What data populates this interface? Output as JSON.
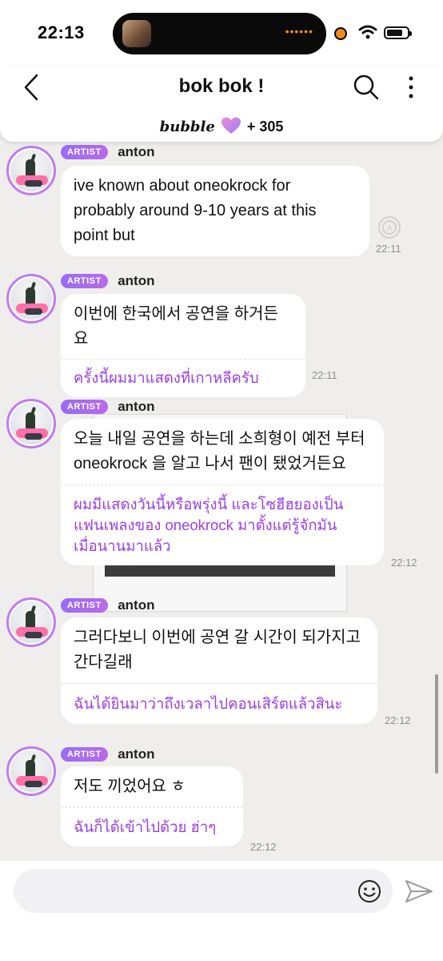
{
  "status_bar": {
    "time": "22:13",
    "island_indicator": "••••••"
  },
  "header": {
    "title": "bok bok !",
    "bubble_label": "bubble",
    "count": "+ 305",
    "icons": {
      "back": "chevron-left-icon",
      "search": "search-icon",
      "more": "more-vertical-icon",
      "heart": "heart-icon"
    }
  },
  "messages": [
    {
      "badge": "ARTIST",
      "name": "anton",
      "text": [
        "ive known about oneokrock for",
        "probably around 9-10 years at this",
        "point but"
      ],
      "translation": [],
      "time": "22:11"
    },
    {
      "badge": "ARTIST",
      "name": "anton",
      "text": [
        "이번에 한국에서 공연을 하거든요"
      ],
      "translation": [
        "ครั้งนี้ผมมาแสดงที่เกาหลีครับ"
      ],
      "time": "22:11"
    },
    {
      "badge": "ARTIST",
      "name": "anton",
      "text": [
        "오늘 내일 공연을 하는데 소희형이 예전 부터",
        "oneokrock 을 알고 나서 팬이 됐었거든요"
      ],
      "translation": [
        "ผมมีแสดงวันนี้หรือพรุ่งนี้ และโซฮีฮยองเป็น",
        "แฟนเพลงของ oneokrock มาตั้งแต่รู้จักมัน",
        "เมื่อนานมาแล้ว"
      ],
      "time": "22:12"
    },
    {
      "badge": "ARTIST",
      "name": "anton",
      "text": [
        "그러다보니 이번에 공연 갈 시간이 되가지고",
        "간다길래"
      ],
      "translation": [
        "ฉันได้ยินมาว่าถึงเวลาไปคอนเสิร์ตแล้วสินะ"
      ],
      "time": "22:12"
    },
    {
      "badge": "ARTIST",
      "name": "anton",
      "text": [
        "저도 끼었어요 ㅎ"
      ],
      "translation": [
        "ฉันก็ได้เข้าไปด้วย ฮ่าๆ"
      ],
      "time": "22:12"
    }
  ],
  "input": {
    "placeholder": "",
    "icons": {
      "emoji": "smiley-icon",
      "send": "send-icon"
    }
  },
  "colors": {
    "accent": "#9b3fe0",
    "badge": "#a36cf0",
    "background": "#efeeec"
  }
}
